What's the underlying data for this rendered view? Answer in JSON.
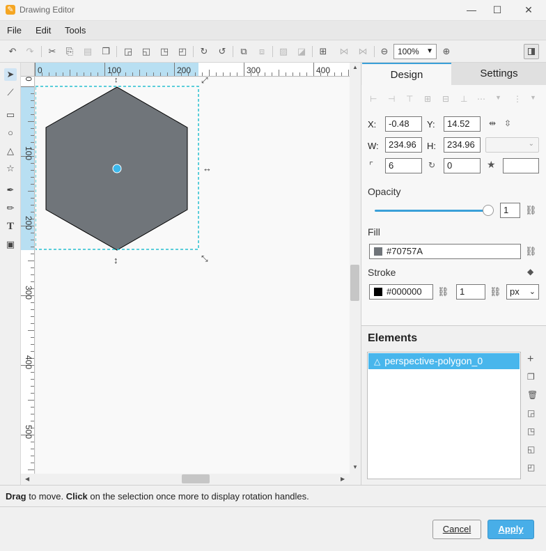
{
  "window": {
    "title": "Drawing Editor",
    "app_icon": "pen-icon",
    "minimize": "—",
    "maximize": "☐",
    "close": "✕"
  },
  "menu": [
    {
      "label": "File"
    },
    {
      "label": "Edit"
    },
    {
      "label": "Tools"
    }
  ],
  "toolbar": {
    "zoom": "100%"
  },
  "rulers": {
    "horizontal": [
      "0",
      "100",
      "200",
      "300",
      "400"
    ],
    "vertical": [
      "0",
      "100",
      "200",
      "300",
      "400",
      "500"
    ]
  },
  "panel": {
    "tabs": [
      {
        "label": "Design"
      },
      {
        "label": "Settings"
      }
    ],
    "x_label": "X:",
    "x_value": "-0.48",
    "y_label": "Y:",
    "y_value": "14.52",
    "w_label": "W:",
    "w_value": "234.96",
    "h_label": "H:",
    "h_value": "234.96",
    "corner_radius": "6",
    "rotation": "0",
    "star_value": "",
    "opacity_label": "Opacity",
    "opacity_value": "1",
    "opacity_fraction": 1.0,
    "fill_label": "Fill",
    "fill_value": "#70757A",
    "stroke_label": "Stroke",
    "stroke_value": "#000000",
    "stroke_width": "1",
    "stroke_unit": "px",
    "elements_title": "Elements",
    "elements": [
      {
        "name": "perspective-polygon_0"
      }
    ]
  },
  "colors": {
    "fill": "#70757A",
    "stroke": "#000000",
    "accent": "#48b6ec",
    "selection": "#27c0d0"
  },
  "status": {
    "drag_bold": "Drag",
    "drag_text": " to move. ",
    "click_bold": "Click",
    "click_text": " on the selection once more to display rotation handles."
  },
  "footer": {
    "cancel": "Cancel",
    "apply": "Apply"
  }
}
